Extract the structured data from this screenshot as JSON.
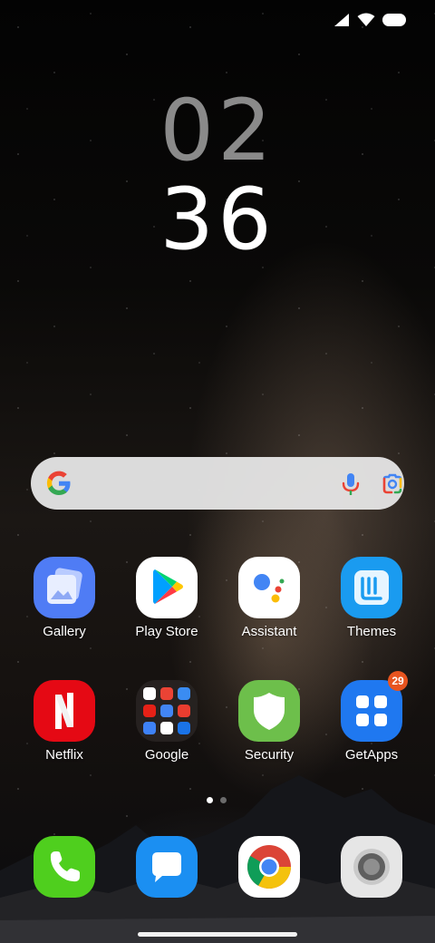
{
  "status_bar": {
    "icons": [
      "cellular-signal-icon",
      "wifi-icon",
      "battery-icon"
    ]
  },
  "clock": {
    "hour": "02",
    "minute": "36"
  },
  "search_bar": {
    "icons": [
      "google-g-icon",
      "microphone-icon",
      "google-lens-icon"
    ]
  },
  "apps": {
    "row1": [
      {
        "label": "Gallery",
        "icon": "gallery-icon"
      },
      {
        "label": "Play Store",
        "icon": "play-store-icon"
      },
      {
        "label": "Assistant",
        "icon": "assistant-icon"
      },
      {
        "label": "Themes",
        "icon": "themes-icon"
      }
    ],
    "row2": [
      {
        "label": "Netflix",
        "icon": "netflix-icon"
      },
      {
        "label": "Google",
        "icon": "google-folder-icon"
      },
      {
        "label": "Security",
        "icon": "security-icon"
      },
      {
        "label": "GetApps",
        "icon": "getapps-icon",
        "badge": "29"
      }
    ]
  },
  "dock": [
    {
      "icon": "phone-icon"
    },
    {
      "icon": "messages-icon"
    },
    {
      "icon": "chrome-icon"
    },
    {
      "icon": "camera-icon"
    }
  ],
  "page_indicator": {
    "pages": 2,
    "current": 1
  },
  "colors": {
    "gallery": "#4f7cf5",
    "play_store_bg": "#ffffff",
    "themes": "#1a9bf0",
    "netflix": "#e50914",
    "security": "#6dbf4b",
    "getapps": "#1f78f0",
    "badge": "#e8541f",
    "phone": "#4fcf1e",
    "messages": "#1b8ff2",
    "chrome_bg": "#ffffff",
    "camera_bg": "#e6e6e6"
  }
}
